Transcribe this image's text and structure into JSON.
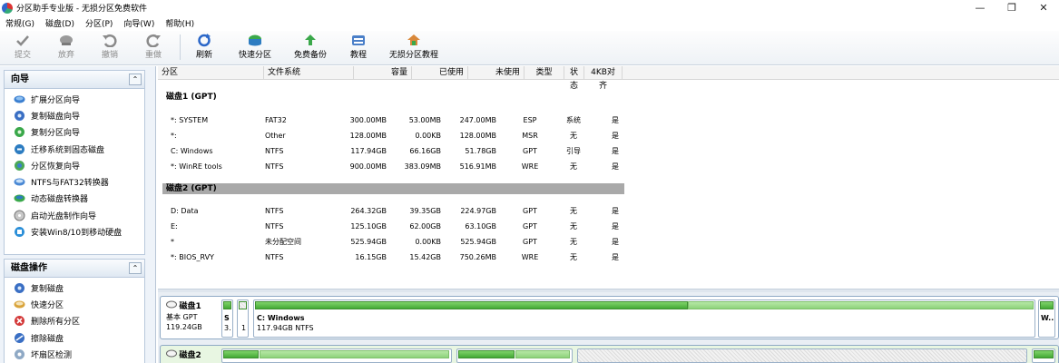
{
  "window": {
    "title": "分区助手专业版 - 无损分区免费软件",
    "minimize": "—",
    "maximize": "❐",
    "close": "✕"
  },
  "menu": [
    "常规(G)",
    "磁盘(D)",
    "分区(P)",
    "向导(W)",
    "帮助(H)"
  ],
  "toolbar": {
    "commit": "提交",
    "discard": "放弃",
    "undo": "撤销",
    "redo": "重做",
    "refresh": "刷新",
    "quick_partition": "快速分区",
    "backup": "免费备份",
    "tutorial": "教程",
    "lossless_tutorial": "无损分区教程"
  },
  "wizard_panel": {
    "title": "向导",
    "collapse": "⌃",
    "items": [
      {
        "label": "扩展分区向导",
        "icon": "extend-partition-icon"
      },
      {
        "label": "复制磁盘向导",
        "icon": "copy-disk-icon"
      },
      {
        "label": "复制分区向导",
        "icon": "copy-partition-icon"
      },
      {
        "label": "迁移系统到固态磁盘",
        "icon": "migrate-os-icon"
      },
      {
        "label": "分区恢复向导",
        "icon": "partition-recovery-icon"
      },
      {
        "label": "NTFS与FAT32转换器",
        "icon": "ntfs-fat32-convert-icon"
      },
      {
        "label": "动态磁盘转换器",
        "icon": "dynamic-disk-icon"
      },
      {
        "label": "启动光盘制作向导",
        "icon": "bootable-disc-icon"
      },
      {
        "label": "安装Win8/10到移动硬盘",
        "icon": "windows-to-go-icon"
      }
    ]
  },
  "disk_ops_panel": {
    "title": "磁盘操作",
    "collapse": "⌃",
    "items": [
      {
        "label": "复制磁盘",
        "icon": "copy-disk-icon"
      },
      {
        "label": "快速分区",
        "icon": "quick-partition-icon"
      },
      {
        "label": "删除所有分区",
        "icon": "delete-all-icon"
      },
      {
        "label": "擦除磁盘",
        "icon": "wipe-disk-icon"
      },
      {
        "label": "坏扇区检测",
        "icon": "bad-sector-icon"
      }
    ]
  },
  "columns": [
    "分区",
    "文件系统",
    "容量",
    "已使用",
    "未使用",
    "类型",
    "状态",
    "4KB对齐"
  ],
  "disks": [
    {
      "header": "磁盘1 (GPT)",
      "rows": [
        [
          "*: SYSTEM",
          "FAT32",
          "300.00MB",
          "53.00MB",
          "247.00MB",
          "ESP",
          "系统",
          "是"
        ],
        [
          "*:",
          "Other",
          "128.00MB",
          "0.00KB",
          "128.00MB",
          "MSR",
          "无",
          "是"
        ],
        [
          "C: Windows",
          "NTFS",
          "117.94GB",
          "66.16GB",
          "51.78GB",
          "GPT",
          "引导",
          "是"
        ],
        [
          "*: WinRE tools",
          "NTFS",
          "900.00MB",
          "383.09MB",
          "516.91MB",
          "WRE",
          "无",
          "是"
        ]
      ]
    },
    {
      "header": "磁盘2 (GPT)",
      "rows": [
        [
          "D: Data",
          "NTFS",
          "264.32GB",
          "39.35GB",
          "224.97GB",
          "GPT",
          "无",
          "是"
        ],
        [
          "E:",
          "NTFS",
          "125.10GB",
          "62.00GB",
          "63.10GB",
          "GPT",
          "无",
          "是"
        ],
        [
          "*",
          "未分配空间",
          "525.94GB",
          "0.00KB",
          "525.94GB",
          "GPT",
          "无",
          "是"
        ],
        [
          "*: BIOS_RVY",
          "NTFS",
          "16.15GB",
          "15.42GB",
          "750.26MB",
          "WRE",
          "无",
          "是"
        ]
      ]
    }
  ],
  "diskmap": {
    "disk1": {
      "name": "磁盘1",
      "type": "基本 GPT",
      "size": "119.24GB",
      "p1_label": "S",
      "p1_sub": "3.",
      "p2_sub": "1",
      "p3_name": "C: Windows",
      "p3_info": "117.94GB NTFS",
      "p4_label": "W..."
    },
    "disk2": {
      "name": "磁盘2"
    }
  },
  "colors": {
    "used_bar": "#44a935",
    "panel_bg": "#eef3f9",
    "disk_header_bg": "#a9a9a9"
  }
}
